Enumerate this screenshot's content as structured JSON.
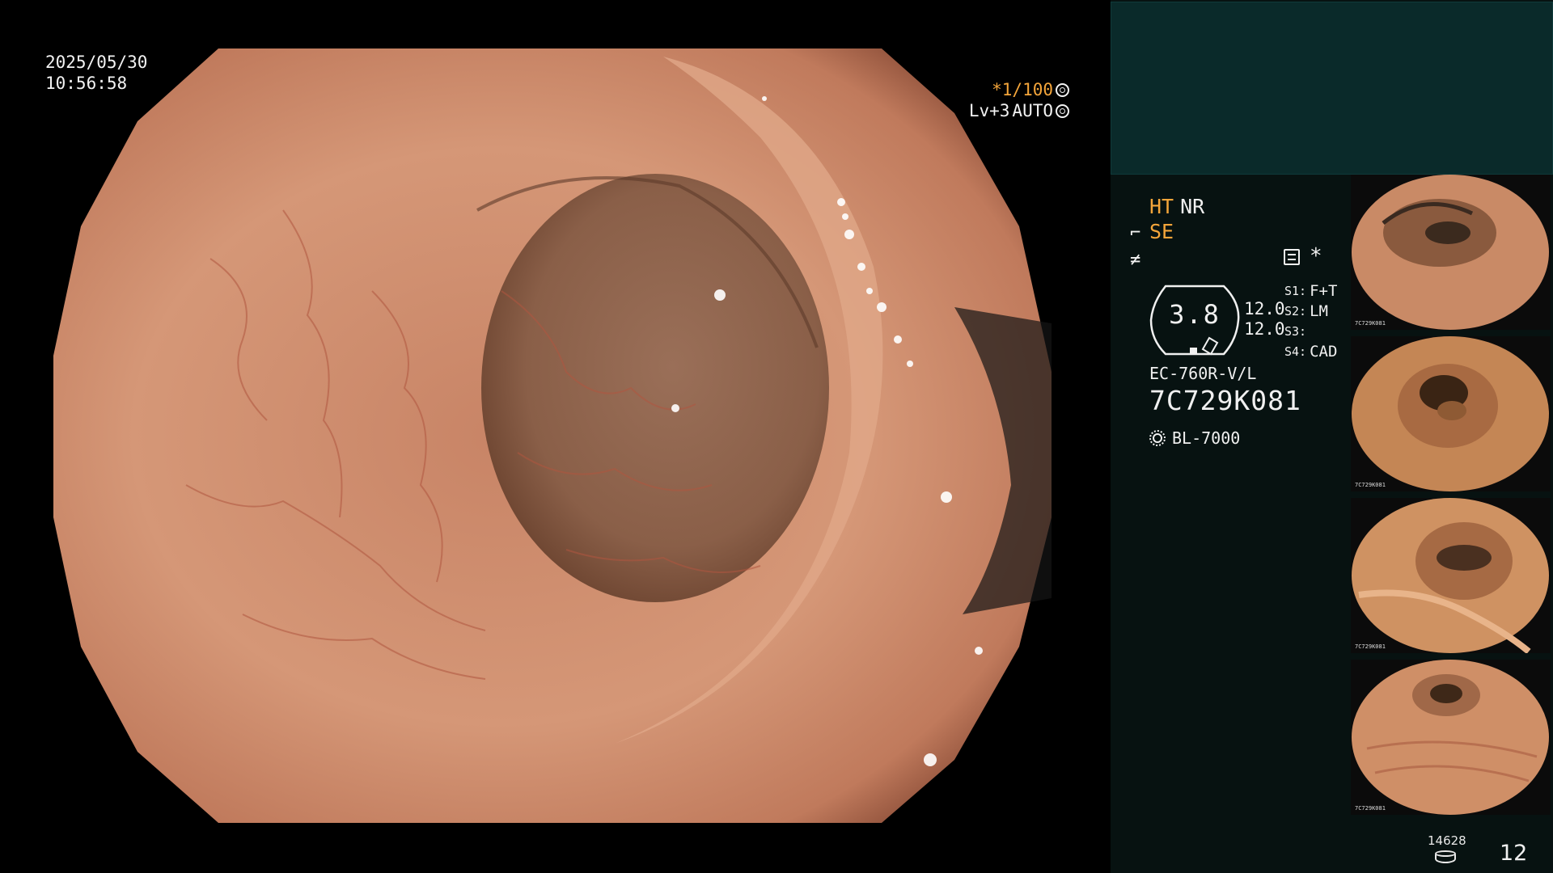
{
  "overlay": {
    "date": "2025/05/30",
    "time": "10:56:58",
    "shutter_speed": "*1/100",
    "level": "Lv+3",
    "mode": "AUTO"
  },
  "panel": {
    "mode_ht": "HT",
    "mode_nr": "NR",
    "mode_se": "SE",
    "gauge_value": "3.8",
    "dual_values": [
      "12.0",
      "12.0"
    ],
    "s_settings": [
      {
        "key": "S1:",
        "value": "F+T"
      },
      {
        "key": "S2:",
        "value": "LM"
      },
      {
        "key": "S3:",
        "value": ""
      },
      {
        "key": "S4:",
        "value": "CAD"
      }
    ],
    "model": "EC-760R-V/L",
    "serial": "7C729K081",
    "light_source": "BL-7000",
    "asterisk": "*"
  },
  "thumbnails": [
    {
      "caption": "7C729K081"
    },
    {
      "caption": "7C729K081"
    },
    {
      "caption": "7C729K081"
    },
    {
      "caption": "7C729K081"
    }
  ],
  "footer": {
    "remaining": "14628",
    "page": "12"
  },
  "colors": {
    "accent_orange": "#f4a53a",
    "panel_bg": "#071211",
    "top_box_bg": "#0a2a2a"
  },
  "icons": [
    "shutter-wheel-icon",
    "iris-icon",
    "settings-list-icon",
    "light-source-icon",
    "storage-disk-icon",
    "scope-tip-icon",
    "flash-icon"
  ]
}
